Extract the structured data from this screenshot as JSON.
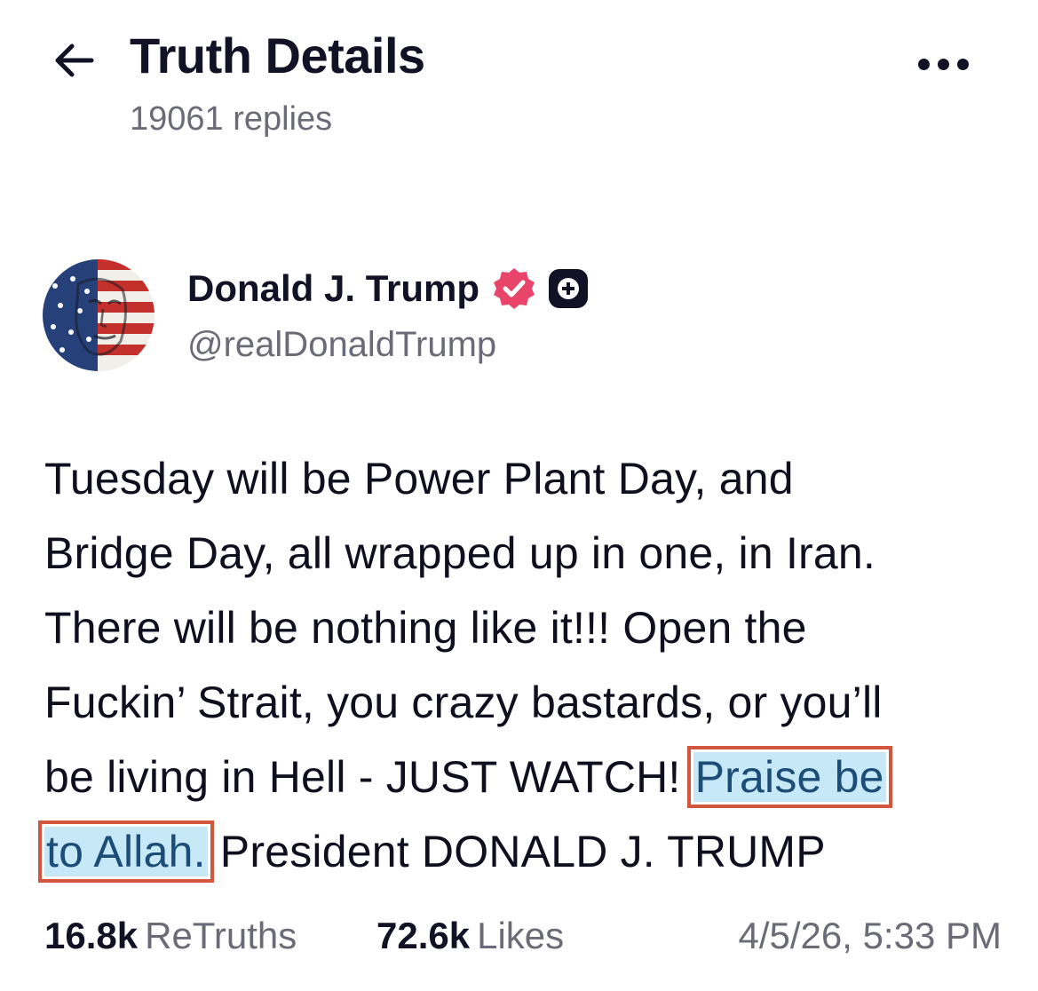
{
  "header": {
    "title": "Truth Details",
    "replies": "19061 replies",
    "back_icon": "arrow-left-icon",
    "more_icon": "more-horizontal-icon"
  },
  "author": {
    "name": "Donald J. Trump",
    "handle": "@realDonaldTrump",
    "verified_icon": "verified-badge-icon",
    "plus_icon": "plus-badge-icon",
    "avatar_icon": "avatar-flag-portrait"
  },
  "post": {
    "line1": "Tuesday will be Power Plant Day, and",
    "line2": "Bridge Day, all wrapped up in one, in Iran.",
    "line3": "There will be nothing like it!!! Open the",
    "line4": "Fuckin’ Strait, you crazy bastards, or you’ll",
    "line5_plain": "be living in Hell - JUST WATCH! ",
    "line5_highlight": "Praise be",
    "line6_highlight": "to Allah.",
    "line6_plain": " President DONALD J. TRUMP"
  },
  "stats": {
    "retruths_count": "16.8k",
    "retruths_label": "ReTruths",
    "likes_count": "72.6k",
    "likes_label": "Likes",
    "timestamp": "4/5/26, 5:33 PM"
  },
  "colors": {
    "text": "#121226",
    "muted": "#6b6b78",
    "verified": "#e9456a",
    "highlight_bg": "#c7e8f7",
    "highlight_text": "#1c4d77",
    "highlight_border": "#d2563d"
  }
}
